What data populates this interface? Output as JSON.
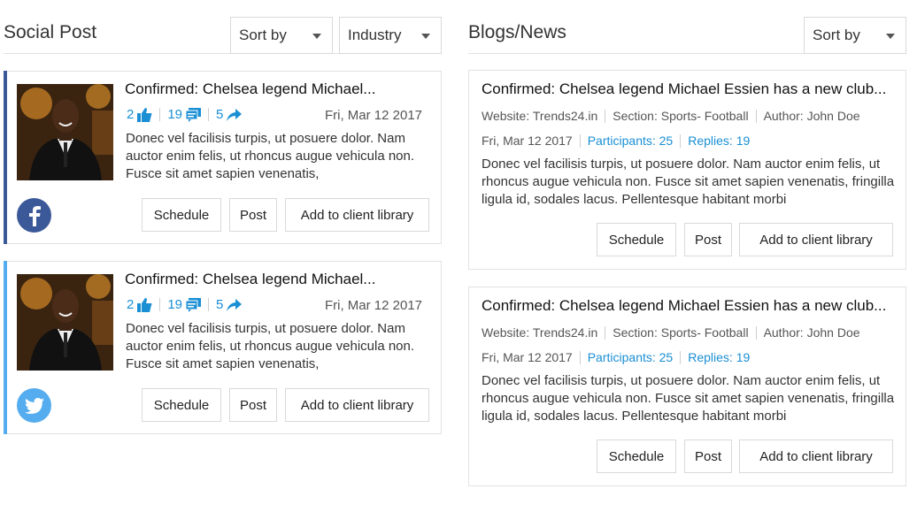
{
  "social": {
    "title": "Social Post",
    "sort_label": "Sort by",
    "industry_label": "Industry",
    "posts": [
      {
        "network": "facebook",
        "accent": "#3b5998",
        "title": "Confirmed: Chelsea legend Michael...",
        "likes": "2",
        "comments": "19",
        "shares": "5",
        "date": "Fri, Mar 12 2017",
        "body": "Donec vel facilisis turpis, ut posuere dolor. Nam auctor enim felis, ut rhoncus augue vehicula non. Fusce sit amet sapien venenatis,",
        "network_icon": "f",
        "buttons": {
          "schedule": "Schedule",
          "post": "Post",
          "library": "Add to client library"
        }
      },
      {
        "network": "twitter",
        "accent": "#55acee",
        "title": "Confirmed: Chelsea legend Michael...",
        "likes": "2",
        "comments": "19",
        "shares": "5",
        "date": "Fri, Mar 12 2017",
        "body": "Donec vel facilisis turpis, ut posuere dolor. Nam auctor enim felis, ut rhoncus augue vehicula non. Fusce sit amet sapien venenatis,",
        "network_icon": "twitter-bird",
        "buttons": {
          "schedule": "Schedule",
          "post": "Post",
          "library": "Add to client library"
        }
      }
    ]
  },
  "blogs": {
    "title": "Blogs/News",
    "sort_label": "Sort by",
    "posts": [
      {
        "title": "Confirmed: Chelsea legend Michael Essien has a new club...",
        "website": "Website: Trends24.in",
        "section": "Section: Sports- Football",
        "author": "Author: John Doe",
        "date": "Fri, Mar 12 2017",
        "participants": "Participants: 25",
        "replies": "Replies: 19",
        "body": "Donec vel facilisis turpis, ut posuere dolor. Nam auctor enim felis, ut rhoncus augue vehicula non. Fusce sit amet sapien venenatis, fringilla ligula id, sodales lacus. Pellentesque habitant morbi",
        "buttons": {
          "schedule": "Schedule",
          "post": "Post",
          "library": "Add to client library"
        }
      },
      {
        "title": "Confirmed: Chelsea legend Michael Essien has a new club...",
        "website": "Website: Trends24.in",
        "section": "Section: Sports- Football",
        "author": "Author: John Doe",
        "date": "Fri, Mar 12 2017",
        "participants": "Participants: 25",
        "replies": "Replies: 19",
        "body": "Donec vel facilisis turpis, ut posuere dolor. Nam auctor enim felis, ut rhoncus augue vehicula non. Fusce sit amet sapien venenatis, fringilla ligula id, sodales lacus. Pellentesque habitant morbi",
        "buttons": {
          "schedule": "Schedule",
          "post": "Post",
          "library": "Add to client library"
        }
      }
    ]
  },
  "colors": {
    "link_blue": "#1a8fd4",
    "facebook": "#3b5998",
    "twitter": "#55acee"
  }
}
